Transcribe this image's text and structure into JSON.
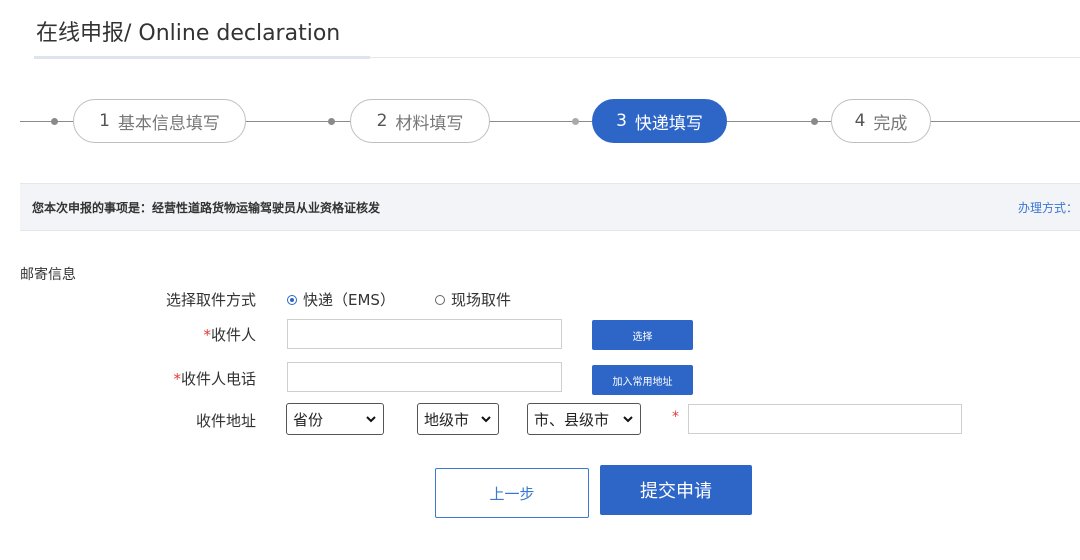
{
  "header": {
    "title": "在线申报/ Online declaration"
  },
  "steps": [
    {
      "num": "1",
      "label": "基本信息填写",
      "active": false
    },
    {
      "num": "2",
      "label": "材料填写",
      "active": false
    },
    {
      "num": "3",
      "label": "快递填写",
      "active": true
    },
    {
      "num": "4",
      "label": "完成",
      "active": false
    }
  ],
  "notice": {
    "label": "您本次申报的事项是：经营性道路货物运输驾驶员从业资格证核发",
    "link": "办理方式："
  },
  "mail_section": {
    "title": "邮寄信息",
    "pickup": {
      "label": "选择取件方式",
      "options": [
        "快递（EMS）",
        "现场取件"
      ],
      "selected": "快递（EMS）"
    },
    "recipient": {
      "label": "收件人",
      "required_mark": "*",
      "value": "",
      "button": "选择"
    },
    "phone": {
      "label": "收件人电话",
      "required_mark": "*",
      "value": "",
      "button": "加入常用地址"
    },
    "address": {
      "label": "收件地址",
      "province": "省份",
      "city": "地级市",
      "county": "市、县级市",
      "required_mark": "*",
      "detail_value": ""
    }
  },
  "actions": {
    "prev": "上一步",
    "submit": "提交申请"
  },
  "colors": {
    "primary": "#2e66c8",
    "link": "#3a78d4",
    "required": "#e03a3a"
  }
}
